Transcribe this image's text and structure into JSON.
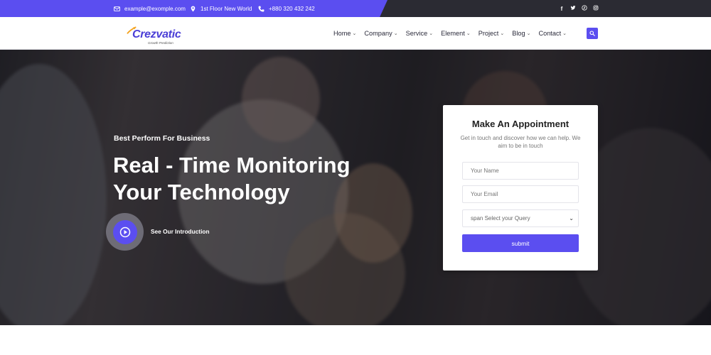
{
  "topbar": {
    "email": "example@exomple.com",
    "address": "1st Floor New World",
    "phone": "+880 320 432 242",
    "social_icons": [
      "facebook-icon",
      "twitter-icon",
      "pinterest-icon",
      "instagram-icon"
    ],
    "colors": {
      "accent": "#5b4ef0",
      "dark": "#2b2b33"
    }
  },
  "nav": {
    "logo_text": "Crezvatic",
    "logo_tagline": "Growth Prediction",
    "items": [
      {
        "label": "Home"
      },
      {
        "label": "Company"
      },
      {
        "label": "Service"
      },
      {
        "label": "Element"
      },
      {
        "label": "Project"
      },
      {
        "label": "Blog"
      },
      {
        "label": "Contact"
      }
    ]
  },
  "hero": {
    "subtitle": "Best Perform For Business",
    "title": "Real - Time Monitoring Your Technology",
    "video_label": "See Our Introduction"
  },
  "form": {
    "title": "Make An Appointment",
    "description": "Get in touch and discover how we can help. We aim to be in touch",
    "name_placeholder": "Your Name",
    "email_placeholder": "Your Email",
    "select_value": "span Select your Query",
    "submit_label": "submit"
  }
}
